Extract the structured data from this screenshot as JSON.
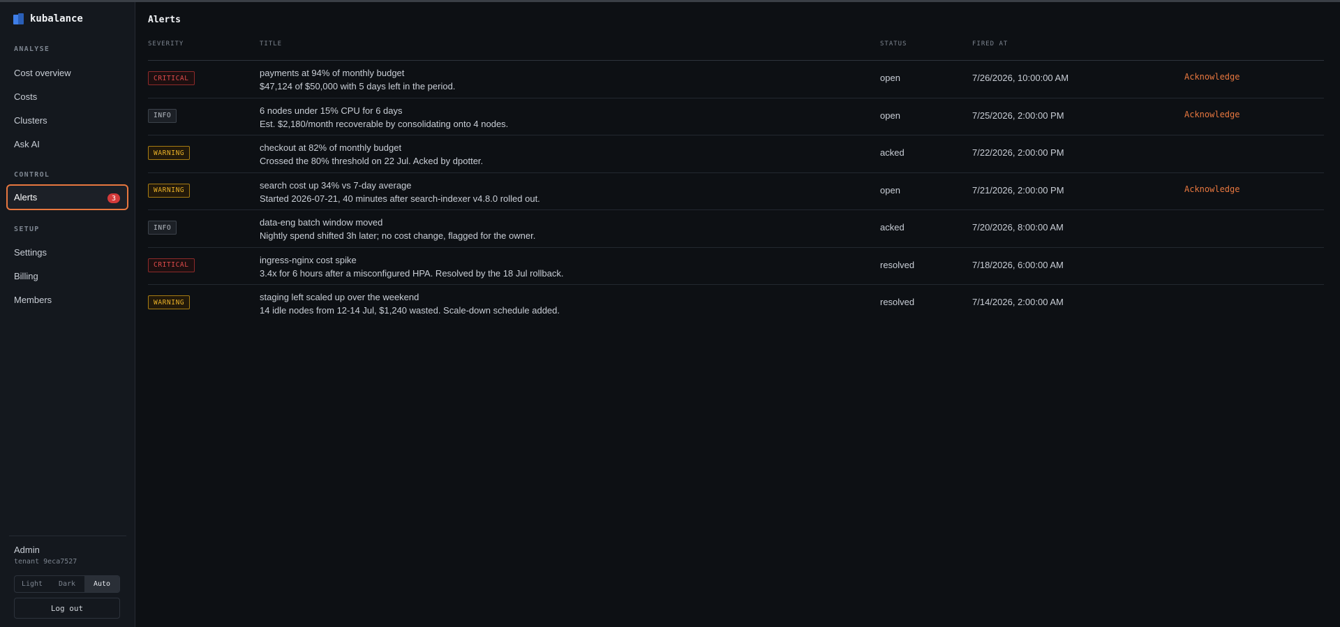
{
  "brand": {
    "name": "kubalance",
    "icon": "kubalance-logo-icon"
  },
  "sidebar": {
    "sections": [
      {
        "title": "ANALYSE",
        "items": [
          {
            "label": "Cost overview"
          },
          {
            "label": "Costs"
          },
          {
            "label": "Clusters"
          },
          {
            "label": "Ask AI"
          }
        ]
      },
      {
        "title": "CONTROL",
        "items": [
          {
            "label": "Alerts",
            "badge": "3",
            "active": true
          }
        ]
      },
      {
        "title": "SETUP",
        "items": [
          {
            "label": "Settings"
          },
          {
            "label": "Billing"
          },
          {
            "label": "Members"
          }
        ]
      }
    ],
    "user": {
      "name": "Admin",
      "tenant": "tenant 9eca7527"
    },
    "theme": {
      "options": [
        "Light",
        "Dark",
        "Auto"
      ],
      "selected": "Auto"
    },
    "logout_label": "Log out"
  },
  "page": {
    "title": "Alerts",
    "columns": {
      "severity": "SEVERITY",
      "title": "TITLE",
      "status": "STATUS",
      "fired_at": "FIRED AT"
    },
    "ack_label": "Acknowledge",
    "rows": [
      {
        "severity": "CRITICAL",
        "title": "payments at 94% of monthly budget",
        "detail": "$47,124 of $50,000 with 5 days left in the period.",
        "status": "open",
        "fired_at": "7/26/2026, 10:00:00 AM",
        "ack": true
      },
      {
        "severity": "INFO",
        "title": "6 nodes under 15% CPU for 6 days",
        "detail": "Est. $2,180/month recoverable by consolidating onto 4 nodes.",
        "status": "open",
        "fired_at": "7/25/2026, 2:00:00 PM",
        "ack": true
      },
      {
        "severity": "WARNING",
        "title": "checkout at 82% of monthly budget",
        "detail": "Crossed the 80% threshold on 22 Jul. Acked by dpotter.",
        "status": "acked",
        "fired_at": "7/22/2026, 2:00:00 PM",
        "ack": false
      },
      {
        "severity": "WARNING",
        "title": "search cost up 34% vs 7-day average",
        "detail": "Started 2026-07-21, 40 minutes after search-indexer v4.8.0 rolled out.",
        "status": "open",
        "fired_at": "7/21/2026, 2:00:00 PM",
        "ack": true
      },
      {
        "severity": "INFO",
        "title": "data-eng batch window moved",
        "detail": "Nightly spend shifted 3h later; no cost change, flagged for the owner.",
        "status": "acked",
        "fired_at": "7/20/2026, 8:00:00 AM",
        "ack": false
      },
      {
        "severity": "CRITICAL",
        "title": "ingress-nginx cost spike",
        "detail": "3.4x for 6 hours after a misconfigured HPA. Resolved by the 18 Jul rollback.",
        "status": "resolved",
        "fired_at": "7/18/2026, 6:00:00 AM",
        "ack": false
      },
      {
        "severity": "WARNING",
        "title": "staging left scaled up over the weekend",
        "detail": "14 idle nodes from 12-14 Jul, $1,240 wasted. Scale-down schedule added.",
        "status": "resolved",
        "fired_at": "7/14/2026, 2:00:00 AM",
        "ack": false
      }
    ]
  },
  "colors": {
    "accent": "#e8773f",
    "critical": "#e04b4b",
    "warning": "#e9b028",
    "info": "#b8bdc4"
  }
}
